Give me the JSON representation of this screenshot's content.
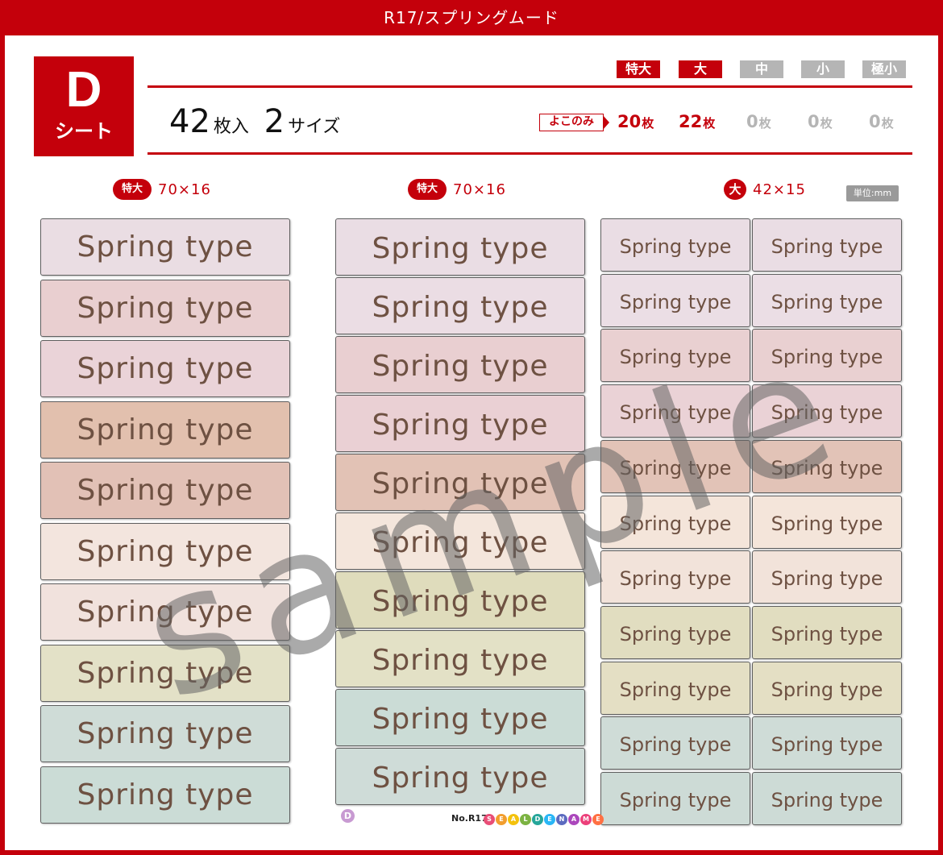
{
  "title": "R17/スプリングムード",
  "sheet": {
    "letter": "D",
    "word": "シート"
  },
  "count": {
    "sheets": "42",
    "sheets_unit": "枚入",
    "sizes": "2",
    "sizes_unit": "サイズ"
  },
  "size_tabs": [
    {
      "label": "特大",
      "active": true
    },
    {
      "label": "大",
      "active": true
    },
    {
      "label": "中",
      "active": false
    },
    {
      "label": "小",
      "active": false
    },
    {
      "label": "極小",
      "active": false
    }
  ],
  "orientation": "よこのみ",
  "size_counts": [
    {
      "value": "20",
      "unit": "枚",
      "active": true
    },
    {
      "value": "22",
      "unit": "枚",
      "active": true
    },
    {
      "value": "0",
      "unit": "枚",
      "active": false
    },
    {
      "value": "0",
      "unit": "枚",
      "active": false
    },
    {
      "value": "0",
      "unit": "枚",
      "active": false
    }
  ],
  "columns": [
    {
      "badge": "特大",
      "dims": "70×16"
    },
    {
      "badge": "特大",
      "dims": "70×16"
    },
    {
      "badge": "大",
      "dims": "42×15"
    }
  ],
  "unit_label": "単位:mm",
  "label_text": "Spring type",
  "col1_colors": [
    "#eadde3",
    "#e9cfd0",
    "#ead3d8",
    "#e2c0ae",
    "#e2c1b6",
    "#f3e5de",
    "#f1e2dd",
    "#e3e1c7",
    "#cfdcd7",
    "#cbdcd6"
  ],
  "col2_colors": [
    "#eadde4",
    "#ebdde4",
    "#e9cfd1",
    "#ead0d4",
    "#e2c2b5",
    "#f4e6dc",
    "#dfdcbc",
    "#e3e1c6",
    "#cbdcd6",
    "#cfdcd8"
  ],
  "col3_colors": [
    "#eadde4",
    "#ebdee5",
    "#e9d0d1",
    "#ead2d6",
    "#e2c3b7",
    "#f4e5da",
    "#f2e3da",
    "#e1ddc0",
    "#e4dfc4",
    "#cfdcd7",
    "#cddbd6"
  ],
  "watermark": "sample",
  "footer": {
    "badge": "D",
    "number": "No.R17",
    "brand": [
      "S",
      "E",
      "A",
      "L",
      "D",
      "E",
      "N",
      "A",
      "M",
      "E"
    ]
  },
  "brand_colors": [
    "#e94e77",
    "#f29e2e",
    "#f4c20d",
    "#7cb342",
    "#26a69a",
    "#29b6f6",
    "#5c6bc0",
    "#ab47bc",
    "#ec407a",
    "#ff7043"
  ]
}
